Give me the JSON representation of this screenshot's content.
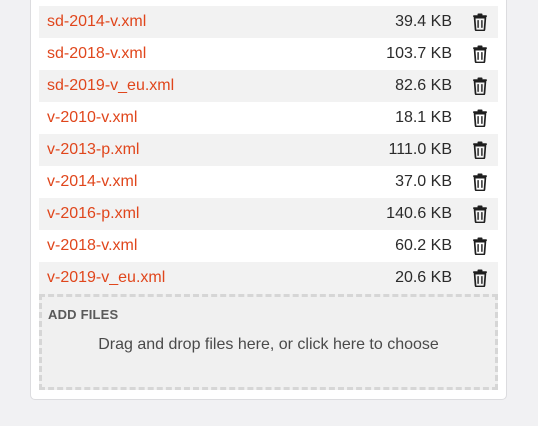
{
  "files": [
    {
      "name": "sd-2014-v.xml",
      "size": "39.4 KB"
    },
    {
      "name": "sd-2018-v.xml",
      "size": "103.7 KB"
    },
    {
      "name": "sd-2019-v_eu.xml",
      "size": "82.6 KB"
    },
    {
      "name": "v-2010-v.xml",
      "size": "18.1 KB"
    },
    {
      "name": "v-2013-p.xml",
      "size": "111.0 KB"
    },
    {
      "name": "v-2014-v.xml",
      "size": "37.0 KB"
    },
    {
      "name": "v-2016-p.xml",
      "size": "140.6 KB"
    },
    {
      "name": "v-2018-v.xml",
      "size": "60.2 KB"
    },
    {
      "name": "v-2019-v_eu.xml",
      "size": "20.6 KB"
    }
  ],
  "delete_icon": "trash-icon",
  "dropzone": {
    "title": "ADD FILES",
    "text": "Drag and drop files here, or click here to choose"
  },
  "colors": {
    "link": "#e0461c",
    "row_alt": "#f2f2f2",
    "page_bg": "#f1f1f3"
  }
}
